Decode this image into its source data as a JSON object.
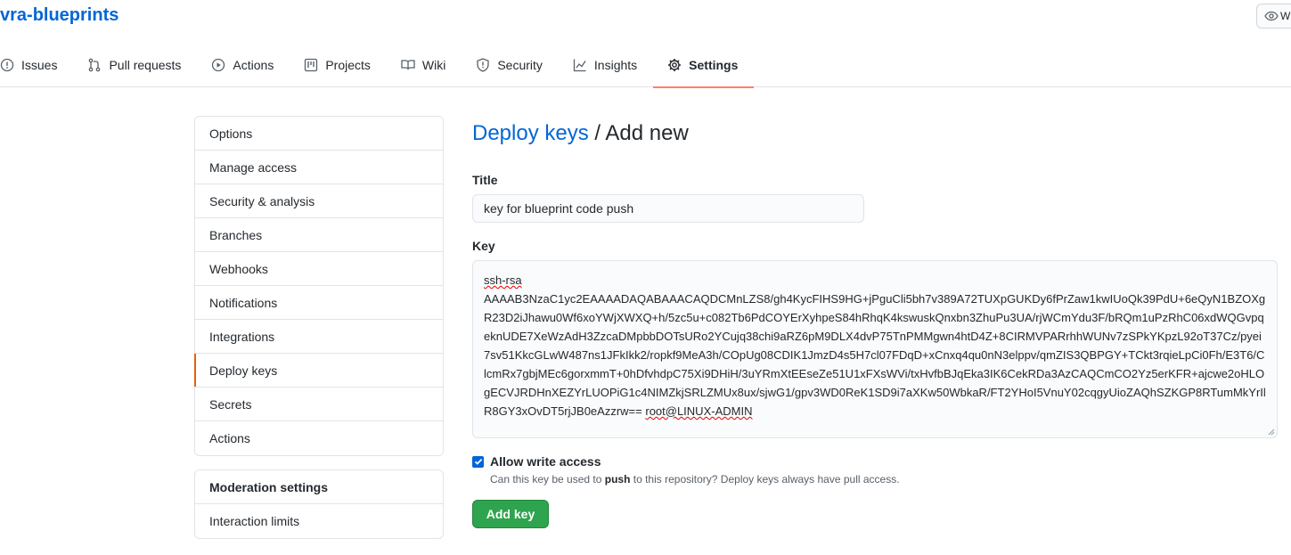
{
  "repo": {
    "name": "vra-blueprints",
    "watch_label": "W"
  },
  "tabs": [
    {
      "label": "Issues",
      "icon": "issue-opened-icon"
    },
    {
      "label": "Pull requests",
      "icon": "git-pull-request-icon"
    },
    {
      "label": "Actions",
      "icon": "play-icon"
    },
    {
      "label": "Projects",
      "icon": "project-icon"
    },
    {
      "label": "Wiki",
      "icon": "book-icon"
    },
    {
      "label": "Security",
      "icon": "shield-icon"
    },
    {
      "label": "Insights",
      "icon": "graph-icon"
    },
    {
      "label": "Settings",
      "icon": "gear-icon",
      "selected": true
    }
  ],
  "sidebar": {
    "items": [
      {
        "label": "Options"
      },
      {
        "label": "Manage access"
      },
      {
        "label": "Security & analysis"
      },
      {
        "label": "Branches"
      },
      {
        "label": "Webhooks"
      },
      {
        "label": "Notifications"
      },
      {
        "label": "Integrations"
      },
      {
        "label": "Deploy keys",
        "selected": true
      },
      {
        "label": "Secrets"
      },
      {
        "label": "Actions"
      }
    ],
    "moderation": {
      "heading": "Moderation settings",
      "items": [
        {
          "label": "Interaction limits"
        }
      ]
    }
  },
  "main": {
    "breadcrumb": "Deploy keys",
    "separator": " / ",
    "title": "Add new",
    "title_label": "Title",
    "title_value": "key for blueprint code push",
    "key_label": "Key",
    "key_prefix": "ssh-rsa",
    "key_body": "AAAAB3NzaC1yc2EAAAADAQABAAACAQDCMnLZS8/gh4KycFIHS9HG+jPguCli5bh7v389A72TUXpGUKDy6fPrZaw1kwIUoQk39PdU+6eQyN1BZOXgR23D2iJhawu0Wf6xoYWjXWXQ+h/5zc5u+c082Tb6PdCOYErXyhpeS84hRhqK4kswuskQnxbn3ZhuPu3UA/rjWCmYdu3F/bRQm1uPzRhC06xdWQGvpqeknUDE7XeWzAdH3ZzcaDMpbbDOTsURo2YCujq38chi9aRZ6pM9DLX4dvP75TnPMMgwn4htD4Z+8CIRMVPARrhhWUNv7zSPkYKpzL92oT37Cz/pyei7sv51KkcGLwW487ns1JFkIkk2/ropkf9MeA3h/COpUg08CDIK1JmzD4s5H7cl07FDqD+xCnxq4qu0nN3elppv/qmZIS3QBPGY+TCkt3rqieLpCi0Fh/E3T6/ClcmRx7gbjMEc6gorxmmT+0hDfvhdpC75Xi9DHiH/3uYRmXtEEseZe51U1xFXsWVi/txHvfbBJqEka3IK6CekRDa3AzCAQCmCO2Yz5erKFR+ajcwe2oHLOgECVJRDHnXEZYrLUOPiG1c4NIMZkjSRLZMUx8ux/sjwG1/gpv3WD0ReK1SD9i7aXKw50WbkaR/FT2YHoI5VnuY02cqgyUioZAQhSZKGP8RTumMkYrIlR8GY3xOvDT5rjJB0eAzzrw==",
    "key_comment": "root@LINUX-ADMIN",
    "allow_write_label": "Allow write access",
    "allow_write_checked": true,
    "allow_write_note_pre": "Can this key be used to ",
    "allow_write_note_bold": "push",
    "allow_write_note_post": " to this repository? Deploy keys always have pull access.",
    "add_button": "Add key"
  },
  "colors": {
    "link": "#0366d6",
    "selected_tab_underline": "#f9826c",
    "primary_button": "#2ea44f"
  }
}
